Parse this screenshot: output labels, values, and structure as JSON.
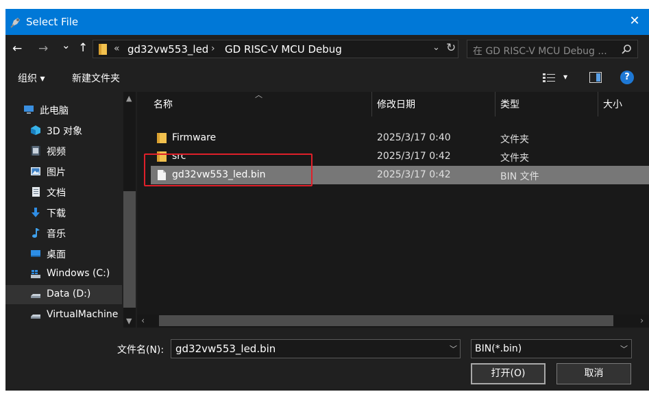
{
  "window": {
    "title": "Select File",
    "close_symbol": "✕"
  },
  "nav": {
    "back_symbol": "←",
    "forward_symbol": "→",
    "recent_symbol": "⌄",
    "up_symbol": "↑",
    "breadcrumb_prefix": "«",
    "breadcrumbs": [
      "gd32vw553_led",
      "GD RISC-V MCU Debug"
    ],
    "breadcrumb_separator": "›",
    "search_placeholder": "在 GD RISC-V MCU Debug ...",
    "refresh_symbol": "↻"
  },
  "toolbar": {
    "organize_label": "组织 ▾",
    "new_folder_label": "新建文件夹",
    "view_dropdown": "▾",
    "help_symbol": "?"
  },
  "sidebar": {
    "items": [
      {
        "label": "此电脑",
        "icon": "pc-icon"
      },
      {
        "label": "3D 对象",
        "icon": "3d-objects-icon"
      },
      {
        "label": "视频",
        "icon": "video-icon"
      },
      {
        "label": "图片",
        "icon": "pictures-icon"
      },
      {
        "label": "文档",
        "icon": "documents-icon"
      },
      {
        "label": "下载",
        "icon": "downloads-icon"
      },
      {
        "label": "音乐",
        "icon": "music-icon"
      },
      {
        "label": "桌面",
        "icon": "desktop-icon"
      },
      {
        "label": "Windows (C:)",
        "icon": "windows-drive-icon"
      },
      {
        "label": "Data (D:)",
        "icon": "drive-icon",
        "selected": true
      },
      {
        "label": "VirtualMachine",
        "icon": "drive-icon"
      }
    ]
  },
  "columns": {
    "name": "名称",
    "modified": "修改日期",
    "type": "类型",
    "size": "大小"
  },
  "files": [
    {
      "name": "Firmware",
      "modified": "2025/3/17 0:40",
      "type": "文件夹",
      "icon": "folder-icon"
    },
    {
      "name": "src",
      "modified": "2025/3/17 0:42",
      "type": "文件夹",
      "icon": "folder-icon"
    },
    {
      "name": "gd32vw553_led.bin",
      "modified": "2025/3/17 0:42",
      "type": "BIN 文件",
      "icon": "file-icon",
      "selected": true
    }
  ],
  "bottom": {
    "filename_label": "文件名(N):",
    "filename_value": "gd32vw553_led.bin",
    "filetype_value": "BIN(*.bin)",
    "open_label": "打开(O)",
    "cancel_label": "取消"
  },
  "colors": {
    "accent": "#0078d7",
    "background": "#202020",
    "content_bg": "#191919",
    "selection": "#777777",
    "highlight_box": "#e0202a",
    "folder": "#f2c14e"
  }
}
